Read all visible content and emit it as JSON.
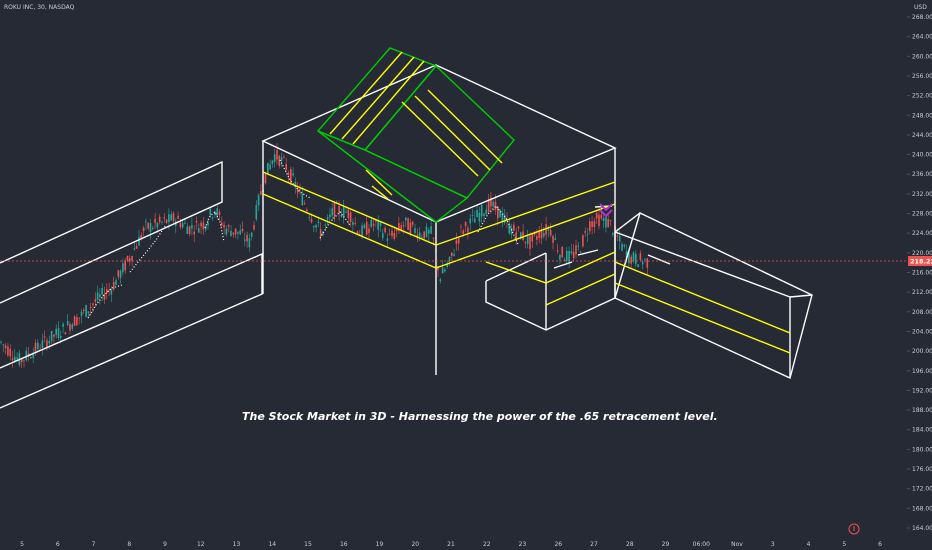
{
  "header": {
    "symbol_line": "ROKU INC, 30, NASDAQ"
  },
  "currency": "USD",
  "last_price_label": "218.22",
  "annotation": "The Stock Market in 3D - Harnessing the power of the .65 retracement level.",
  "colors": {
    "background": "#262a35",
    "drawing_white": "#ffffff",
    "drawing_yellow": "#ffff00",
    "drawing_green": "#00cc00",
    "candle_up": "#26a69a",
    "candle_down": "#ef5350",
    "price_line": "#ef5350",
    "marker_purple": "#b030d0"
  },
  "chart_data": {
    "type": "candlestick",
    "title": "",
    "ylim": [
      162,
      270
    ],
    "y_ticks": [
      164,
      168,
      172,
      176,
      180,
      184,
      188,
      192,
      196,
      200,
      204,
      208,
      212,
      216,
      220,
      224,
      228,
      232,
      236,
      240,
      244,
      248,
      252,
      256,
      260,
      264,
      268
    ],
    "x_ticks": [
      "5",
      "6",
      "7",
      "8",
      "9",
      "12",
      "13",
      "14",
      "15",
      "16",
      "19",
      "20",
      "21",
      "22",
      "23",
      "26",
      "27",
      "28",
      "29",
      "06:00",
      "Nov",
      "3",
      "4",
      "5",
      "6"
    ],
    "last_price": 218.22,
    "price_path": [
      [
        0,
        202
      ],
      [
        20,
        198
      ],
      [
        40,
        201
      ],
      [
        60,
        204
      ],
      [
        80,
        207
      ],
      [
        100,
        211
      ],
      [
        112,
        213
      ],
      [
        130,
        219
      ],
      [
        145,
        225
      ],
      [
        160,
        226
      ],
      [
        175,
        227
      ],
      [
        190,
        225
      ],
      [
        205,
        226
      ],
      [
        215,
        229
      ],
      [
        225,
        225
      ],
      [
        240,
        224
      ],
      [
        250,
        222
      ],
      [
        258,
        230
      ],
      [
        266,
        236
      ],
      [
        275,
        240
      ],
      [
        285,
        238
      ],
      [
        295,
        234
      ],
      [
        305,
        230
      ],
      [
        315,
        226
      ],
      [
        322,
        224
      ],
      [
        335,
        229
      ],
      [
        350,
        228
      ],
      [
        360,
        224
      ],
      [
        375,
        226
      ],
      [
        390,
        223
      ],
      [
        405,
        226
      ],
      [
        420,
        224
      ],
      [
        432,
        224
      ],
      [
        440,
        215
      ],
      [
        450,
        218
      ],
      [
        460,
        224
      ],
      [
        470,
        226
      ],
      [
        480,
        228
      ],
      [
        490,
        230
      ],
      [
        500,
        228
      ],
      [
        510,
        225
      ],
      [
        520,
        224
      ],
      [
        530,
        222
      ],
      [
        540,
        224
      ],
      [
        550,
        225
      ],
      [
        560,
        220
      ],
      [
        570,
        219
      ],
      [
        580,
        221
      ],
      [
        590,
        226
      ],
      [
        600,
        227
      ],
      [
        610,
        226
      ],
      [
        620,
        222
      ],
      [
        630,
        219
      ],
      [
        640,
        218.5
      ],
      [
        648,
        218.2
      ]
    ]
  }
}
